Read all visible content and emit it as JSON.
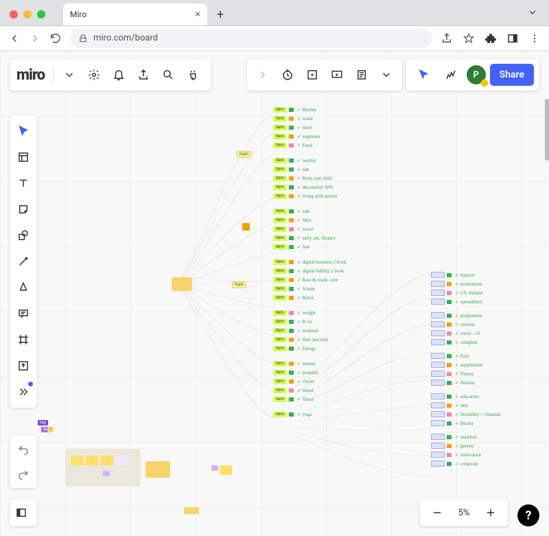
{
  "browser": {
    "tab_title": "Miro",
    "url": "miro.com/board",
    "traffic": {
      "close": "#FF5F57",
      "min": "#FEBC2E",
      "max": "#28C840"
    }
  },
  "top": {
    "logo": "miro",
    "share_label": "Share",
    "avatar_initial": "P"
  },
  "zoom": {
    "value": "5%"
  },
  "mindmap": {
    "center_items": [
      "Beetles",
      "water",
      "more",
      "segments",
      "Food",
      "normal",
      "sun",
      "Body and child",
      "discomfort 10%",
      "living with autism",
      "sale",
      "Skin",
      "wood",
      "early am, finance",
      "Sun",
      "digital business 2 book",
      "digital fidelity 2 book",
      "Raw & ready, sore",
      "Scams",
      "Botox",
      "weight",
      "B vit",
      "nominal",
      "Hair and skin",
      "Energy",
      "mental",
      "prenatal",
      "vision",
      "mood",
      "Shred",
      "yoga"
    ],
    "right_items": [
      "imports",
      "promotions",
      "US, Ireland",
      "spreadsheet",
      "programme",
      "version",
      "covid - 19",
      "complete",
      "Paul",
      "supplement",
      "Fitness",
      "Holistic",
      "education",
      "skin",
      "flexibility + vitamins",
      "Beauty",
      "manifest",
      "generic",
      "motivation",
      "corporate"
    ]
  }
}
